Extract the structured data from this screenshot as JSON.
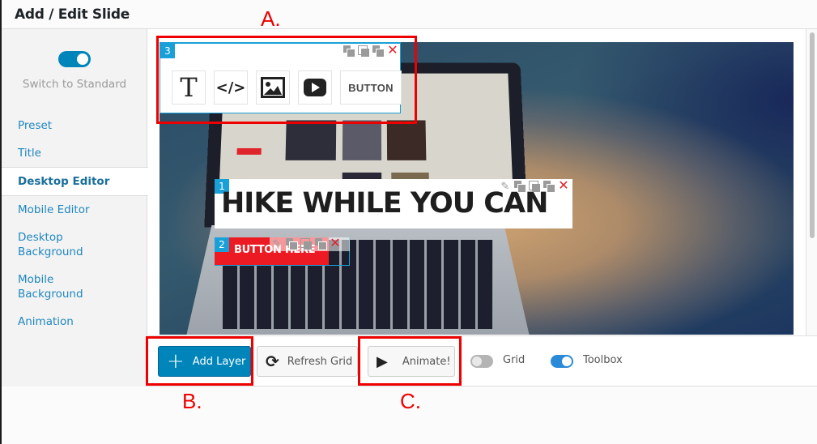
{
  "header": {
    "title": "Add / Edit Slide"
  },
  "sidebar": {
    "mode_toggle": {
      "label": "Switch to Standard",
      "on": true
    },
    "items": [
      {
        "label": "Preset",
        "active": false
      },
      {
        "label": "Title",
        "active": false
      },
      {
        "label": "Desktop Editor",
        "active": true
      },
      {
        "label": "Mobile Editor",
        "active": false
      },
      {
        "label": "Desktop Background",
        "active": false
      },
      {
        "label": "Mobile Background",
        "active": false
      },
      {
        "label": "Animation",
        "active": false
      }
    ]
  },
  "stage": {
    "layers": [
      {
        "number": "1",
        "text": "HIKE WHILE YOU CAN",
        "type": "text"
      },
      {
        "number": "2",
        "text": "BUTTON HERE",
        "type": "button"
      },
      {
        "number": "3",
        "type": "toolbox",
        "tools": [
          {
            "name": "text",
            "glyph": "T"
          },
          {
            "name": "html",
            "glyph": "</>"
          },
          {
            "name": "image",
            "glyph": "image"
          },
          {
            "name": "video",
            "glyph": "play"
          },
          {
            "name": "button",
            "glyph": "BUTTON"
          }
        ]
      }
    ],
    "layer_controls": {
      "close": "✕",
      "edit": "✎"
    }
  },
  "toolbar": {
    "add_layer": "Add Layer",
    "refresh_grid": "Refresh Grid",
    "animate": "Animate!",
    "grid": {
      "label": "Grid",
      "on": false
    },
    "toolbox": {
      "label": "Toolbox",
      "on": true
    }
  },
  "annotations": {
    "a": "A.",
    "b": "B.",
    "c": "C."
  },
  "colors": {
    "accent": "#0085ba",
    "layer_badge": "#1aa0d8",
    "button_red": "#ec1b23",
    "annotation_red": "#ee0000",
    "toggle_on": "#2b8ad8"
  }
}
